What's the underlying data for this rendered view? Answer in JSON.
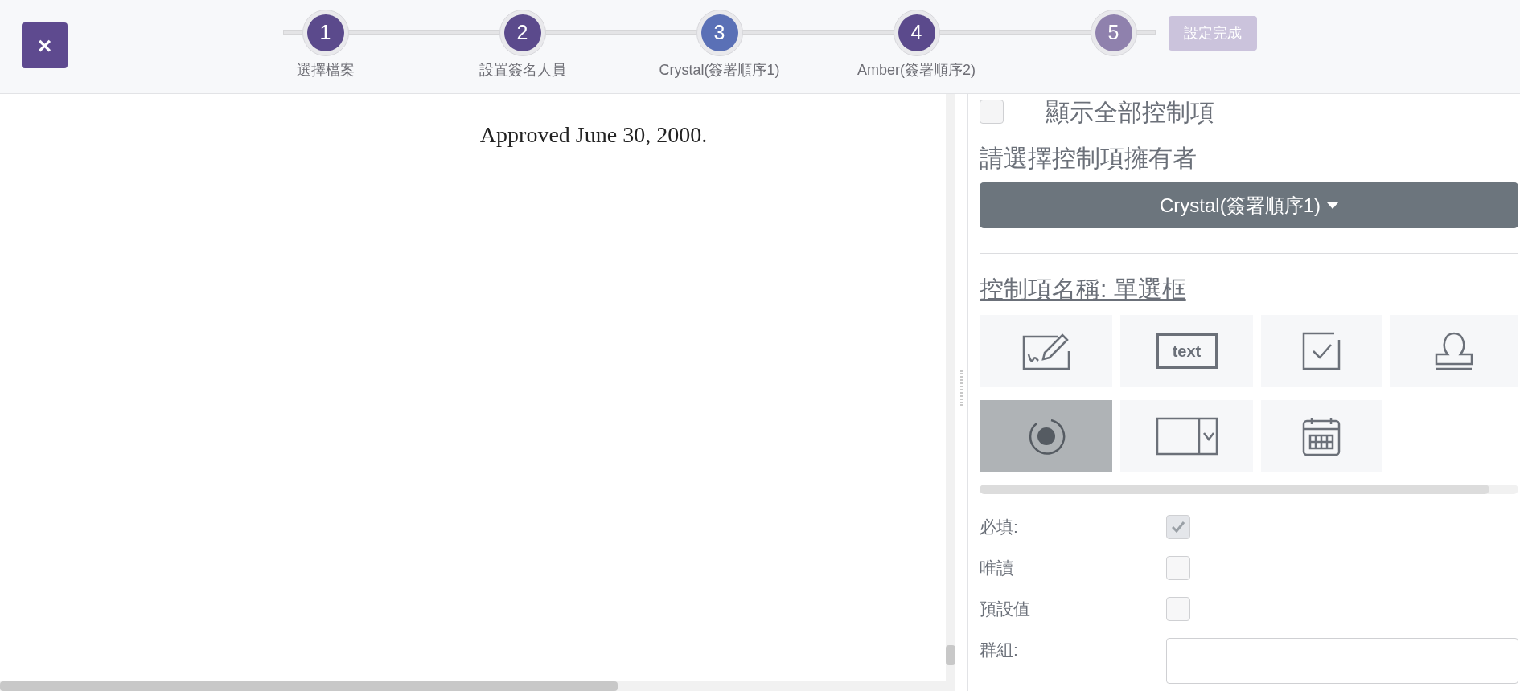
{
  "close_button": {
    "icon": "×"
  },
  "steps": [
    {
      "number": "1",
      "label": "選擇檔案",
      "kind": "done"
    },
    {
      "number": "2",
      "label": "設置簽名人員",
      "kind": "done"
    },
    {
      "number": "3",
      "label": "Crystal(簽署順序1)",
      "kind": "current"
    },
    {
      "number": "4",
      "label": "Amber(簽署順序2)",
      "kind": "done"
    },
    {
      "number": "5",
      "kind": "pending"
    }
  ],
  "finish_button": {
    "label": "設定完成",
    "disabled": true
  },
  "document": {
    "text": "Approved June 30, 2000."
  },
  "panel": {
    "show_all": {
      "label": "顯示全部控制項",
      "checked": false
    },
    "owner_heading": "請選擇控制項擁有者",
    "owner_dropdown": "Crystal(簽署順序1)",
    "control_name": "控制項名稱: 單選框",
    "tools": [
      {
        "kind": "signature",
        "selected": false
      },
      {
        "kind": "text",
        "label": "text",
        "selected": false
      },
      {
        "kind": "checkbox",
        "selected": false
      },
      {
        "kind": "stamp",
        "selected": false
      },
      {
        "kind": "radio",
        "selected": true
      },
      {
        "kind": "dropdown",
        "selected": false
      },
      {
        "kind": "date",
        "selected": false
      }
    ],
    "properties": [
      {
        "kind": "checkbox",
        "label": "必填:",
        "checked": true
      },
      {
        "kind": "checkbox",
        "label": "唯讀",
        "checked": false
      },
      {
        "kind": "checkbox",
        "label": "預設值",
        "checked": false
      },
      {
        "kind": "field",
        "label": "群組:"
      }
    ]
  }
}
